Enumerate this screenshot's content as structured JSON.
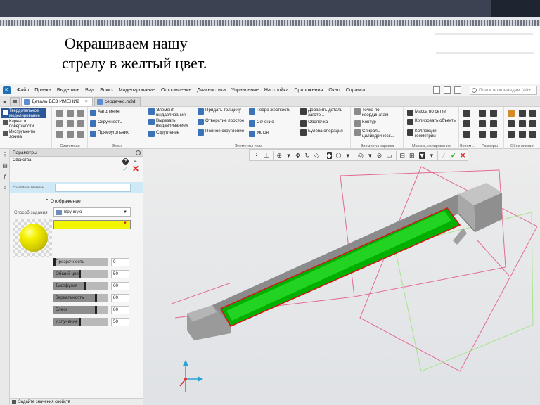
{
  "slide": {
    "title_line1": "Окрашиваем нашу",
    "title_line2": "стрелу в желтый цвет."
  },
  "menubar": {
    "items": [
      "Файл",
      "Правка",
      "Выделить",
      "Вид",
      "Эскиз",
      "Моделирование",
      "Оформление",
      "Диагностика",
      "Управление",
      "Настройка",
      "Приложения",
      "Окно",
      "Справка"
    ],
    "search_placeholder": "Поиск по командам (Alt+"
  },
  "tabs": [
    {
      "label": "Деталь БЕЗ ИМЕНИ2",
      "active": true
    },
    {
      "label": "сердечко.m3d",
      "active": false
    }
  ],
  "ribbon": {
    "mode_left": {
      "active": "Твердотельное моделирование",
      "item2": "Каркас и поверхности",
      "item3": "Инструменты эскиза"
    },
    "sketch_cmds": [
      "Автолиния",
      "Окружность",
      "Прямоугольник"
    ],
    "body_cmds_col1": [
      "Элемент выдавливания",
      "Вырезать выдавливанием",
      "Скругление"
    ],
    "body_cmds_col2": [
      "Придать толщину",
      "Отверстие простое",
      "Полное скругление"
    ],
    "body_cmds_col3": [
      "Ребро жесткости",
      "Сечение",
      "Уклон"
    ],
    "body_cmds_col4": [
      "Добавить деталь-загото...",
      "Оболочка",
      "Булева операция"
    ],
    "frame_cmds": [
      "Точка по координатам",
      "Контур",
      "Спираль цилиндрическ..."
    ],
    "array_cmds": [
      "Масса по сетке",
      "Копировать объекты",
      "Коллекция геометрии"
    ],
    "group_labels": {
      "system": "Системная",
      "sketch": "Эскиз",
      "body": "Элементы тела",
      "frame": "Элементы каркаса",
      "array": "Массив, копирование",
      "aux": "Вспом...",
      "dims": "Размеры",
      "notes": "Обозначения"
    }
  },
  "params_panel": {
    "header": "Параметры",
    "section": "Свойства",
    "name_label": "Наименование",
    "name_value": "",
    "display_header": "Отображение",
    "method_label": "Способ задания",
    "method_value": "Вручную",
    "selected_color": "#f2f500",
    "properties": [
      {
        "label": "Прозрачность",
        "value": "0",
        "level": 0.0
      },
      {
        "label": "Общий цвет",
        "value": "50",
        "level": 0.5
      },
      {
        "label": "Диффузия",
        "value": "60",
        "level": 0.6
      },
      {
        "label": "Зеркальность",
        "value": "80",
        "level": 0.8
      },
      {
        "label": "Блеск",
        "value": "80",
        "level": 0.8
      },
      {
        "label": "Излучение",
        "value": "50",
        "level": 0.5
      }
    ],
    "hint": "Задайте значения свойств"
  }
}
